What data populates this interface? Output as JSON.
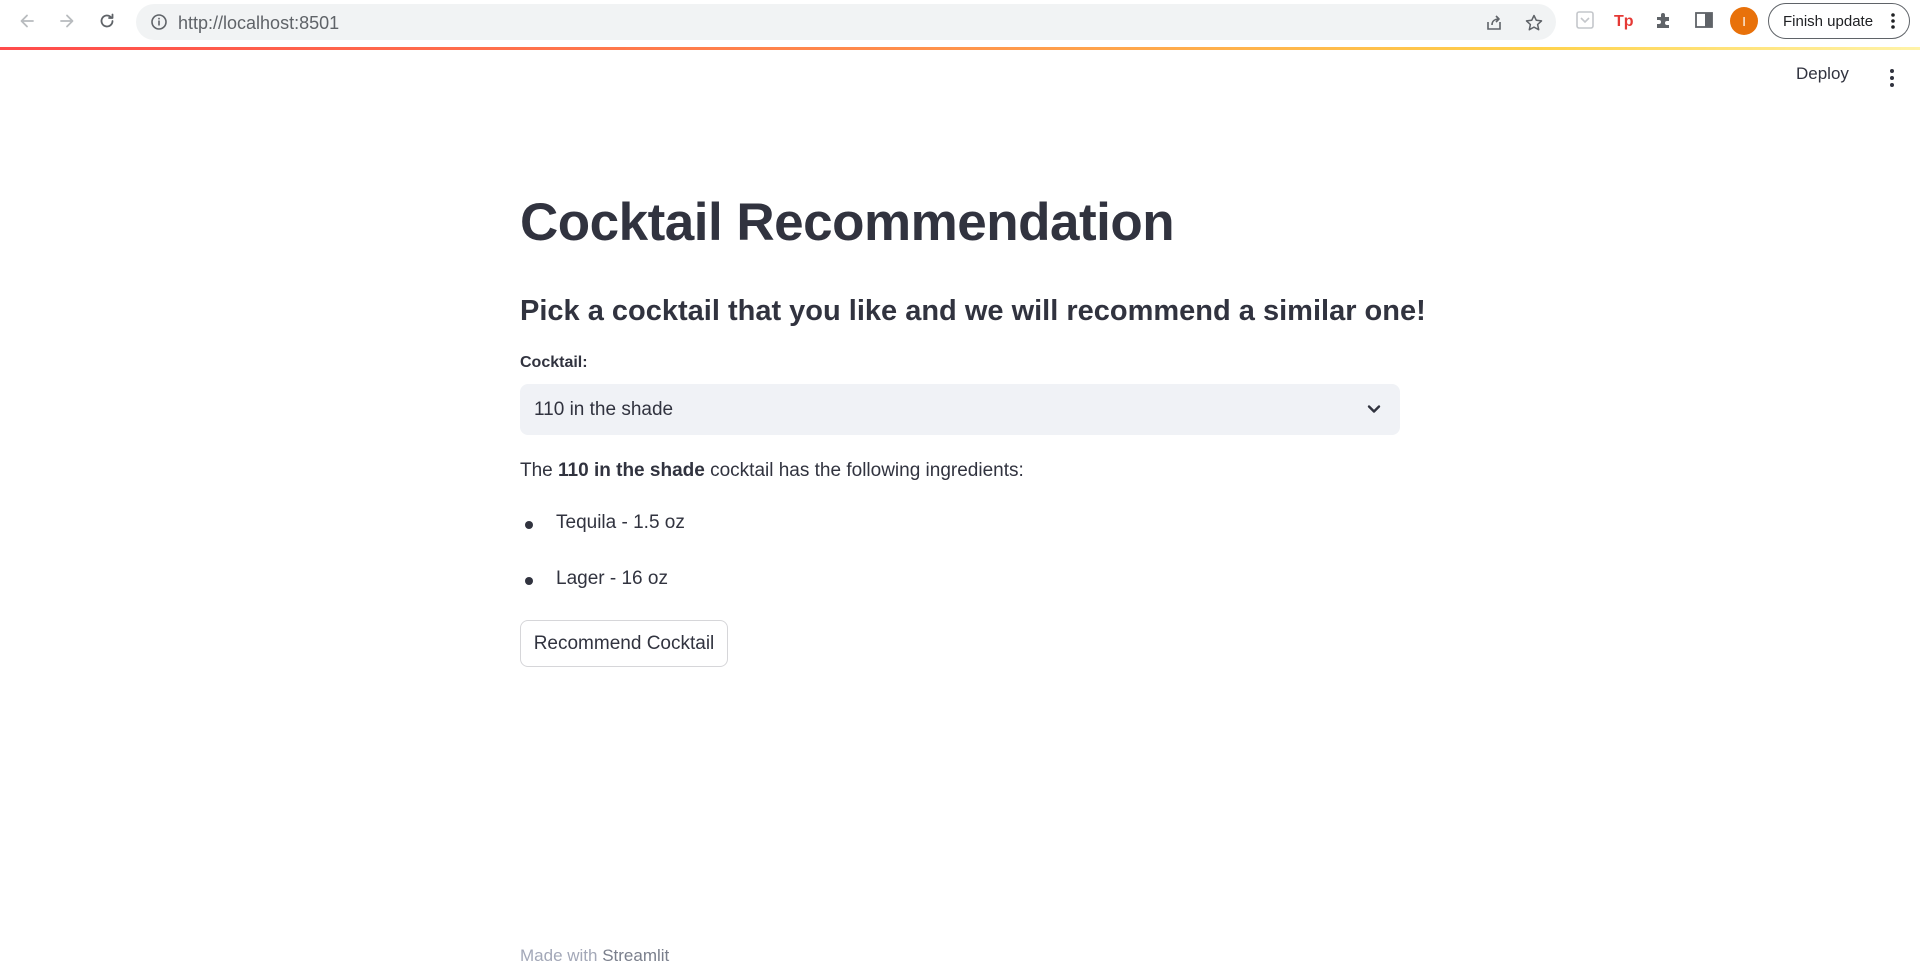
{
  "browser": {
    "url": "http://localhost:8501",
    "profile_initial": "I",
    "finish_update_label": "Finish update",
    "accent_profile_color": "#e8710a"
  },
  "streamlit_header": {
    "deploy_label": "Deploy"
  },
  "main": {
    "title": "Cocktail Recommendation",
    "subtitle": "Pick a cocktail that you like and we will recommend a similar one!",
    "select_label": "Cocktail:",
    "selected_cocktail": "110 in the shade",
    "ingredients_prefix": "The ",
    "ingredients_cocktail": "110 in the shade",
    "ingredients_suffix": " cocktail has the following ingredients:",
    "ingredients": [
      {
        "text": "Tequila - 1.5 oz"
      },
      {
        "text": "Lager - 16 oz"
      }
    ],
    "recommend_button_label": "Recommend Cocktail"
  },
  "footer": {
    "made_with": "Made with ",
    "brand": "Streamlit"
  }
}
